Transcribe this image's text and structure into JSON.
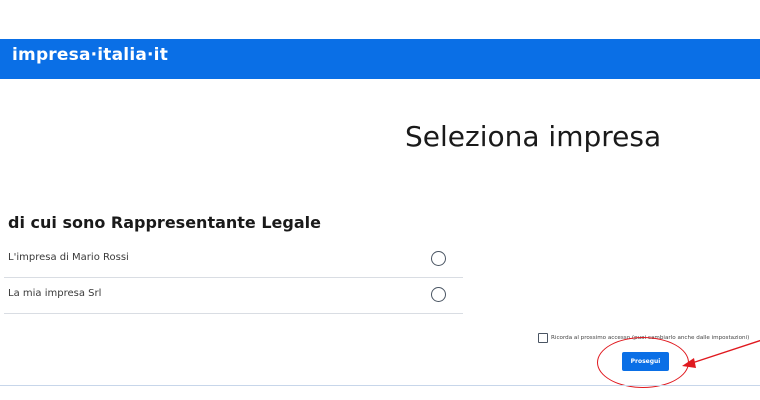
{
  "header": {
    "brand": "impresa·italia·it",
    "background_color": "#0a6fe6"
  },
  "main": {
    "title": "Seleziona impresa",
    "section_heading": "di cui sono Rappresentante Legale",
    "companies": [
      {
        "name": "L'impresa di Mario Rossi",
        "selected": false
      },
      {
        "name": "La mia impresa Srl",
        "selected": false
      }
    ],
    "remember": {
      "checked": false,
      "label": "Ricorda al prossimo accesso (puoi cambiarlo anche dalle impostazioni)"
    },
    "continue_label": "Prosegui"
  },
  "annotation": {
    "color": "#e0191f",
    "shape": "ellipse-with-arrow"
  }
}
